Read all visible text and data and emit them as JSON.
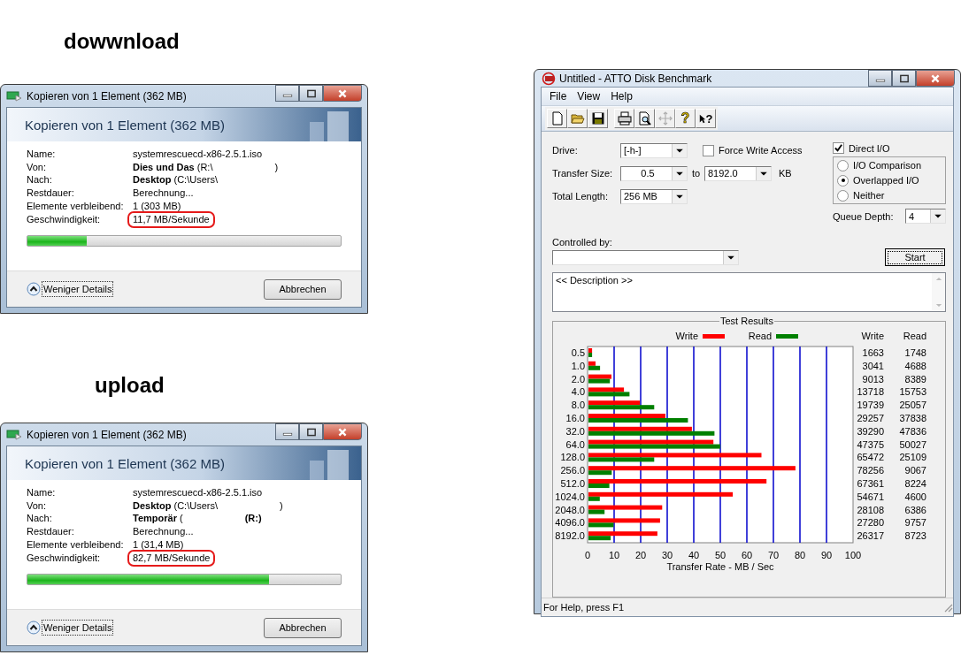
{
  "dialogs": [
    {
      "heading": "dowwnload",
      "title": "Kopieren von 1 Element (362 MB)",
      "header": "Kopieren von 1 Element (362 MB)",
      "fields": [
        {
          "label": "Name:",
          "value": "systemrescuecd-x86-2.5.1.iso",
          "highlighted": false
        },
        {
          "label": "Von:",
          "value": "**Dies und Das** (R:\\",
          "tail": ")",
          "highlighted": false
        },
        {
          "label": "Nach:",
          "value": "**Desktop** (C:\\Users\\",
          "highlighted": false
        },
        {
          "label": "Restdauer:",
          "value": "Berechnung...",
          "highlighted": false
        },
        {
          "label": "Elemente verbleibend:",
          "value": "1 (303 MB)",
          "highlighted": false
        },
        {
          "label": "Geschwindigkeit:",
          "value": "11,7 MB/Sekunde",
          "highlighted": true
        }
      ],
      "progress": {
        "level": 0.19
      },
      "details_button": "Weniger Details",
      "cancel_button": "Abbrechen"
    },
    {
      "heading": "upload",
      "title": "Kopieren von 1 Element (362 MB)",
      "header": "Kopieren von 1 Element (362 MB)",
      "fields": [
        {
          "label": "Name:",
          "value": "systemrescuecd-x86-2.5.1.iso",
          "highlighted": false
        },
        {
          "label": "Von:",
          "value": "**Desktop** (C:\\Users\\",
          "tail": ")",
          "highlighted": false
        },
        {
          "label": "Nach:",
          "value": "**Temporär** (",
          "tail": "**(R:)**",
          "highlighted": false
        },
        {
          "label": "Restdauer:",
          "value": "Berechnung...",
          "highlighted": false
        },
        {
          "label": "Elemente verbleibend:",
          "value": "1 (31,4 MB)",
          "highlighted": false
        },
        {
          "label": "Geschwindigkeit:",
          "value": "82,7 MB/Sekunde",
          "highlighted": true
        }
      ],
      "progress": {
        "level": 0.77
      },
      "details_button": "Weniger Details",
      "cancel_button": "Abbrechen"
    }
  ],
  "atto": {
    "title": "Untitled - ATTO Disk Benchmark",
    "menu": [
      "File",
      "View",
      "Help"
    ],
    "toolbar": [
      {
        "kind": "new",
        "disabled": false
      },
      {
        "kind": "open",
        "disabled": false
      },
      {
        "kind": "save",
        "disabled": false
      },
      {
        "kind": "print",
        "disabled": false
      },
      {
        "kind": "preview",
        "disabled": false
      },
      {
        "kind": "move",
        "disabled": true
      },
      {
        "kind": "help",
        "glyph": "?",
        "disabled": false
      },
      {
        "kind": "context_help",
        "glyph": "?",
        "disabled": false
      }
    ],
    "drive": {
      "label": "Drive:",
      "value": "[-h-]"
    },
    "transfer_size": {
      "label": "Transfer Size:",
      "from": "0.5",
      "to_label": "to",
      "to": "8192.0",
      "unit": "KB"
    },
    "total_length": {
      "label": "Total Length:",
      "value": "256 MB"
    },
    "force_write": {
      "label": "Force Write Access",
      "checked": false
    },
    "direct_io": {
      "label": "Direct I/O",
      "checked": true
    },
    "io_modes": [
      {
        "label": "I/O Comparison",
        "selected": false
      },
      {
        "label": "Overlapped I/O",
        "selected": true
      },
      {
        "label": "Neither",
        "selected": false
      }
    ],
    "queue_depth": {
      "label": "Queue Depth:",
      "value": "4"
    },
    "controlled_by": {
      "label": "Controlled by:"
    },
    "start_button": "Start",
    "description": "<< Description >>",
    "results": {
      "title": "Test Results",
      "table_headers": [
        "Write",
        "Read"
      ],
      "rows": [
        {
          "write": "1663",
          "read": "1748"
        },
        {
          "write": "3041",
          "read": "4688"
        },
        {
          "write": "9013",
          "read": "8389"
        },
        {
          "write": "13718",
          "read": "15753"
        },
        {
          "write": "19739",
          "read": "25057"
        },
        {
          "write": "29257",
          "read": "37838"
        },
        {
          "write": "39290",
          "read": "47836"
        },
        {
          "write": "47375",
          "read": "50027"
        },
        {
          "write": "65472",
          "read": "25109"
        },
        {
          "write": "78256",
          "read": "9067"
        },
        {
          "write": "67361",
          "read": "8224"
        },
        {
          "write": "54671",
          "read": "4600"
        },
        {
          "write": "28108",
          "read": "6386"
        },
        {
          "write": "27280",
          "read": "9757"
        },
        {
          "write": "26317",
          "read": "8723"
        }
      ],
      "chart_data": {
        "type": "bar",
        "orientation": "horizontal",
        "xlabel": "Transfer Rate - MB / Sec",
        "categories": [
          "0.5",
          "1.0",
          "2.0",
          "4.0",
          "8.0",
          "16.0",
          "32.0",
          "64.0",
          "128.0",
          "256.0",
          "512.0",
          "1024.0",
          "2048.0",
          "4096.0",
          "8192.0"
        ],
        "series": [
          {
            "name": "Write",
            "color": "#ff0000",
            "values": [
              1.7,
              3,
              9,
              13.7,
              19.7,
              29.3,
              39.3,
              47.4,
              65.5,
              78.3,
              67.4,
              54.7,
              28.1,
              27.3,
              26.3
            ]
          },
          {
            "name": "Read",
            "color": "#008000",
            "values": [
              1.7,
              4.7,
              8.4,
              15.8,
              25.1,
              37.8,
              47.8,
              50,
              25.1,
              9.1,
              8.2,
              4.6,
              6.4,
              9.8,
              8.7
            ]
          }
        ],
        "xlim": [
          0,
          100
        ],
        "xticks": [
          0,
          10,
          20,
          30,
          40,
          50,
          60,
          70,
          80,
          90,
          100
        ],
        "grid": true,
        "legend": true
      }
    },
    "status": "For Help, press F1"
  }
}
